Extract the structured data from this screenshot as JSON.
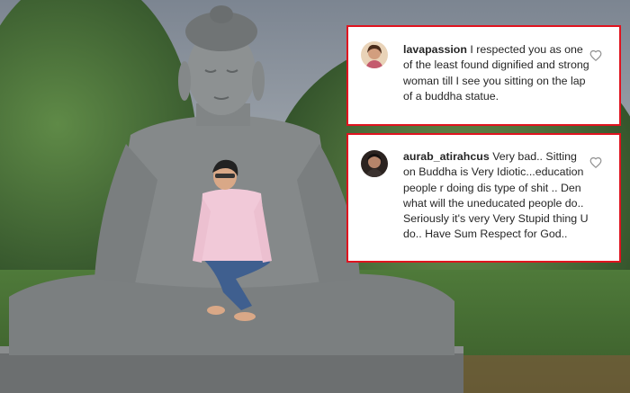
{
  "comments": [
    {
      "username": "lavapassion",
      "text": "I respected you as one of the least found dignified and strong woman till I see you sitting on the lap of a buddha statue.",
      "avatar_icon": "user-avatar-icon",
      "like_icon": "heart-icon"
    },
    {
      "username": "aurab_atirahcus",
      "text": "Very bad.. Sitting on Buddha is Very Idiotic...education people r doing dis type of shit .. Den what will the uneducated people do.. Seriously it's very Very Stupid thing U do.. Have Sum Respect for God..",
      "avatar_icon": "user-avatar-icon",
      "like_icon": "heart-icon"
    }
  ],
  "colors": {
    "highlight_border": "#e0131f",
    "card_background": "#ffffff",
    "text": "#262626",
    "username": "#262626"
  }
}
